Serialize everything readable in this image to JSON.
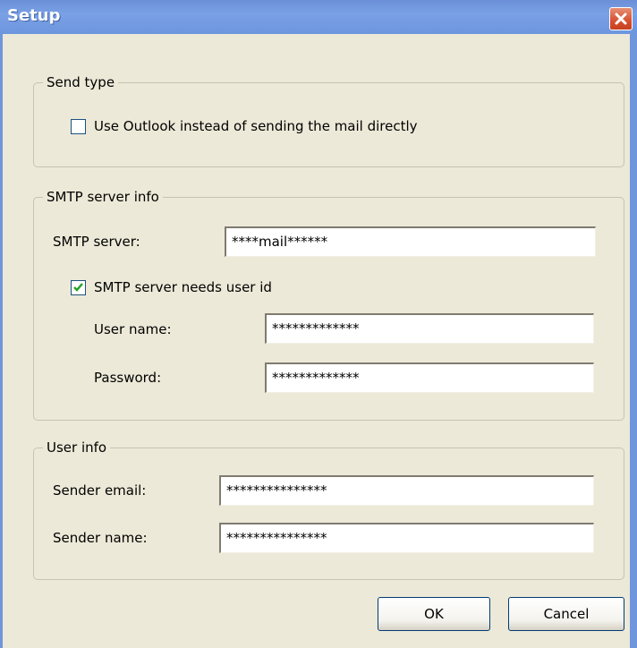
{
  "window": {
    "title": "Setup",
    "close_icon": "close-icon"
  },
  "send_type": {
    "group_label": "Send type",
    "use_outlook": {
      "label": "Use Outlook instead of sending the mail directly",
      "checked": false
    }
  },
  "smtp": {
    "group_label": "SMTP server info",
    "server_label": "SMTP server:",
    "server_value": "****mail******",
    "needs_user_id": {
      "label": "SMTP server needs user id",
      "checked": true
    },
    "user_name_label": "User name:",
    "user_name_value": "*************",
    "password_label": "Password:",
    "password_value": "*************"
  },
  "user_info": {
    "group_label": "User info",
    "sender_email_label": "Sender email:",
    "sender_email_value": "***************",
    "sender_name_label": "Sender name:",
    "sender_name_value": "***************"
  },
  "buttons": {
    "ok": "OK",
    "cancel": "Cancel"
  },
  "colors": {
    "titlebar": "#7aa0e6",
    "close_button": "#d8502f",
    "dialog_bg": "#ece9d8"
  }
}
